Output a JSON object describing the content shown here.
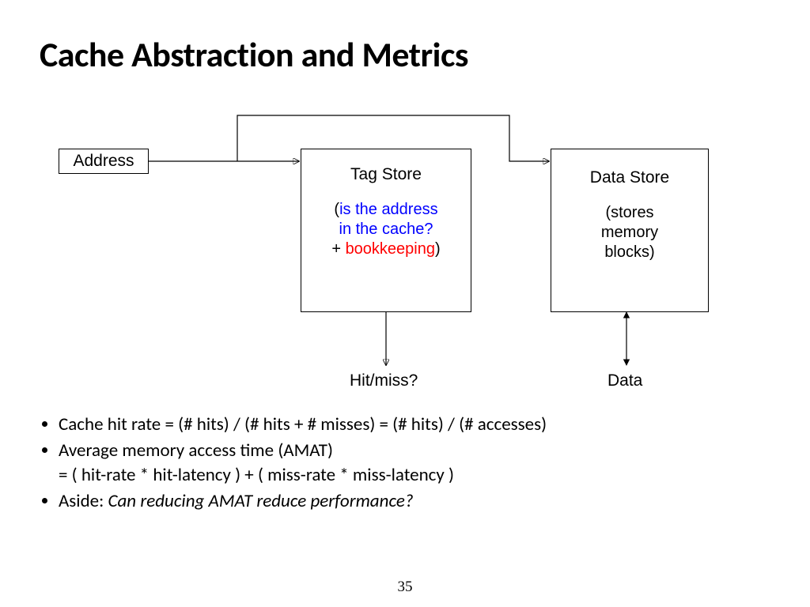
{
  "title": "Cache Abstraction and Metrics",
  "address_label": "Address",
  "tag_store": {
    "heading": "Tag Store",
    "q_line1": "is the address",
    "q_line2": "in the cache?",
    "plus": "+ ",
    "bookkeeping": "bookkeeping"
  },
  "data_store": {
    "heading": "Data Store",
    "line1": "(stores",
    "line2": "memory",
    "line3": "blocks)"
  },
  "hitmiss_label": "Hit/miss?",
  "data_label": "Data",
  "bullets": {
    "b1": "Cache hit rate = (# hits) / (# hits + # misses) = (# hits) / (# accesses)",
    "b2a": "Average memory access time (AMAT)",
    "b2b": "= ( hit-rate * hit-latency ) + ( miss-rate * miss-latency )",
    "b3_prefix": "Aside: ",
    "b3_italic": "Can reducing AMAT reduce performance?"
  },
  "page_number": "35"
}
